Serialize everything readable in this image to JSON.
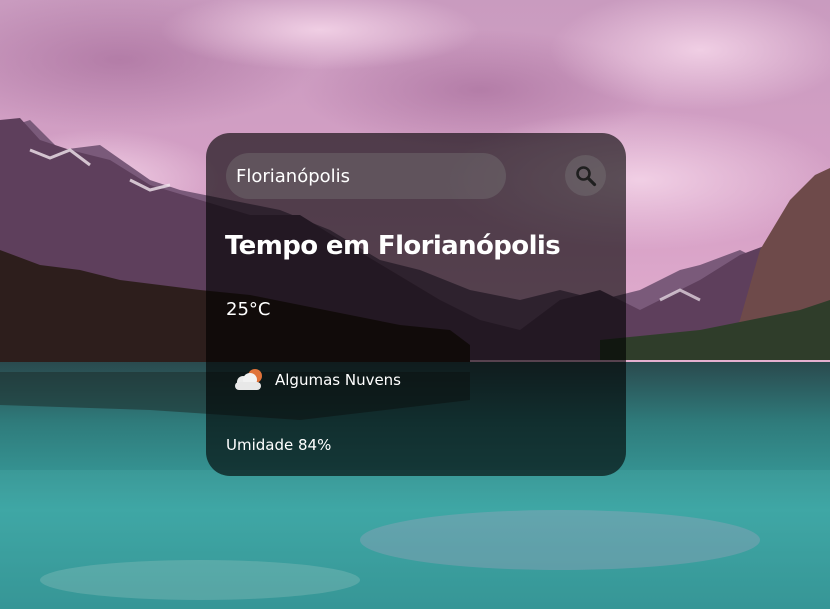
{
  "search": {
    "value": "Florianópolis",
    "placeholder": ""
  },
  "weather": {
    "title": "Tempo em Florianópolis",
    "temperature": "25°C",
    "description": "Algumas Nuvens",
    "humidity": "Umidade 84%",
    "icon": "few-clouds-icon"
  },
  "colors": {
    "card_bg": "#000000",
    "text": "#ffffff",
    "sun": "#e0733a",
    "cloud": "#e8e8e8"
  }
}
